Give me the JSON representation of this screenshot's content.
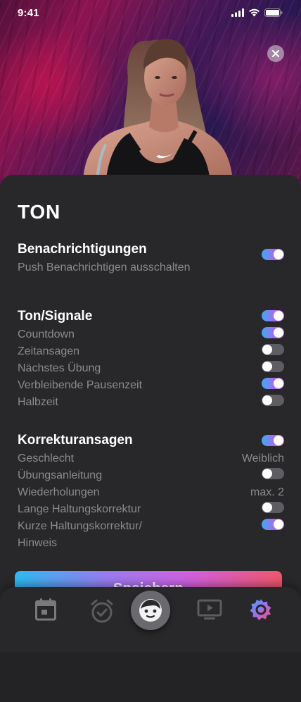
{
  "status_bar": {
    "time": "9:41",
    "icons": [
      "cellular-signal-icon",
      "wifi-icon",
      "battery-icon"
    ]
  },
  "hero": {
    "image": "athlete-portrait-photo",
    "close_icon": "close-icon"
  },
  "settings": {
    "title": "TON",
    "notifications": {
      "title": "Benachrichtigungen",
      "subtitle": "Push Benachrichtigen ausschalten",
      "enabled": true
    },
    "sound": {
      "title": "Ton/Signale",
      "enabled": true,
      "items": [
        {
          "label": "Countdown",
          "enabled": true
        },
        {
          "label": "Zeitansagen",
          "enabled": false
        },
        {
          "label": "Nächstes Übung",
          "enabled": false
        },
        {
          "label": "Verbleibende Pausenzeit",
          "enabled": true
        },
        {
          "label": "Halbzeit",
          "enabled": false
        }
      ]
    },
    "corrections": {
      "title": "Korrekturansagen",
      "enabled": true,
      "gender": {
        "label": "Geschlecht",
        "value": "Weiblich"
      },
      "exercise_instructions": {
        "label": "Übungsanleitung",
        "enabled": false
      },
      "repetitions": {
        "label": "Wiederholungen",
        "value": "max. 2"
      },
      "long_posture": {
        "label": "Lange Haltungskorrektur",
        "enabled": false
      },
      "short_posture": {
        "label": "Kurze Haltungskorrektur/",
        "label_line2": "Hinweis",
        "enabled": true
      }
    }
  },
  "save_button": {
    "label": "Speichern"
  },
  "tabbar": {
    "tabs": [
      {
        "icon": "calendar-icon",
        "active": false
      },
      {
        "icon": "alarm-clock-icon",
        "active": false
      },
      {
        "icon": "profile-face-icon",
        "active": true
      },
      {
        "icon": "video-play-icon",
        "active": false
      },
      {
        "icon": "settings-gear-icon",
        "active": true
      }
    ]
  },
  "colors": {
    "accent_gradient": [
      "#3fa9f5",
      "#a36cf0",
      "#e06ae0"
    ],
    "button_gradient": [
      "#2dbaf0",
      "#9a7af0",
      "#d060e0",
      "#f0566a"
    ],
    "sheet_background": "#28282a",
    "muted_text": "#8b8b8f"
  }
}
